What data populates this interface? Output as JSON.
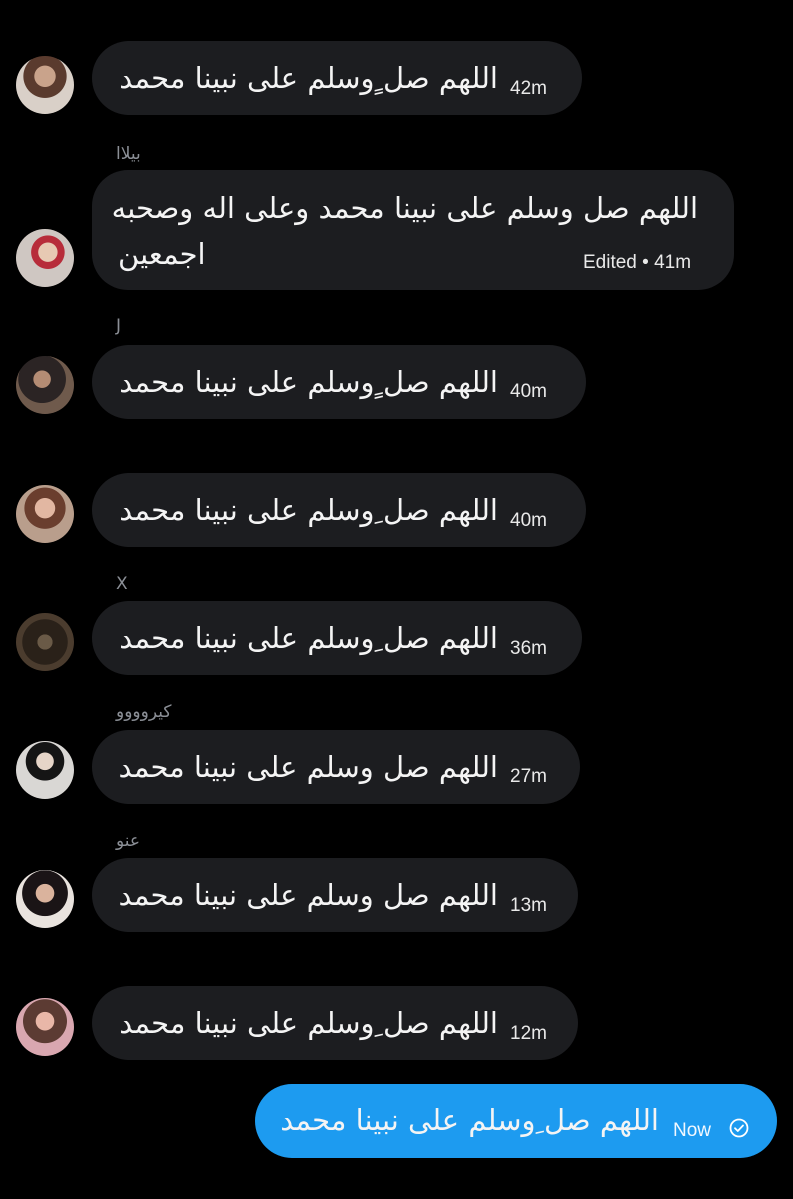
{
  "messages": [
    {
      "sender": "",
      "text": "اللهم صل ٍوسلم على نبينا محمد",
      "time": "42m"
    },
    {
      "sender": "بيلاا",
      "text_line1": "اللهم صل وسلم على نبينا محمد وعلى اله وصحبه",
      "text_line2": "اجمعين",
      "time": "Edited • 41m"
    },
    {
      "sender": "J",
      "text": "اللهم صل ٍوسلم على نبينا محمد",
      "time": "40m"
    },
    {
      "sender": "",
      "text": "اللهم صل ِوسلم على نبينا محمد",
      "time": "40m"
    },
    {
      "sender": "X",
      "text": "اللهم صل ِوسلم على نبينا محمد",
      "time": "36m"
    },
    {
      "sender": "كيروووو",
      "text": "اللهم صل وسلم على نبينا محمد",
      "time": "27m"
    },
    {
      "sender": "عنو",
      "text": "اللهم صل وسلم على نبينا محمد",
      "time": "13m"
    },
    {
      "sender": "",
      "text": "اللهم صل ِوسلم على نبينا محمد",
      "time": "12m"
    }
  ],
  "outgoing": {
    "text": "اللهم صل ِوسلم على نبينا محمد",
    "time": "Now",
    "status_icon": "check-circle-icon"
  },
  "colors": {
    "background": "#000000",
    "bubble": "#1c1d20",
    "outgoing_bubble": "#1d9bf0",
    "sender": "#8b8f96"
  }
}
